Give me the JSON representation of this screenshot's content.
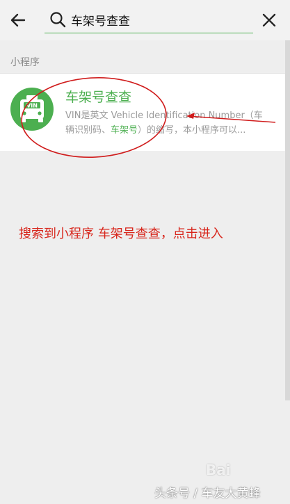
{
  "topbar": {
    "back_icon": "arrow-left-icon",
    "search_icon": "search-icon",
    "search_value": "车架号查查",
    "clear_icon": "close-icon"
  },
  "results": {
    "section_label": "小程序",
    "items": [
      {
        "icon": "vin-car-icon",
        "icon_text": "VIN",
        "name": "车架号查查",
        "desc_line1": "VIN是英文 Vehicle Identification Number（车",
        "desc_line2_before": "辆识别码、",
        "desc_line2_highlight": "车架号",
        "desc_line2_after": "）的缩写，本小程序可以..."
      }
    ]
  },
  "annotation": {
    "text": "搜索到小程序  车架号查查，点击进入",
    "color": "#d8261c"
  },
  "watermark": {
    "text": "头条号 / 车友大黄蜂",
    "baidu_mark": "Bai"
  },
  "colors": {
    "accent": "#4caf50",
    "topbar_bg": "#f2f2f2",
    "page_bg": "#eeeeee",
    "annotation": "#d8261c"
  }
}
